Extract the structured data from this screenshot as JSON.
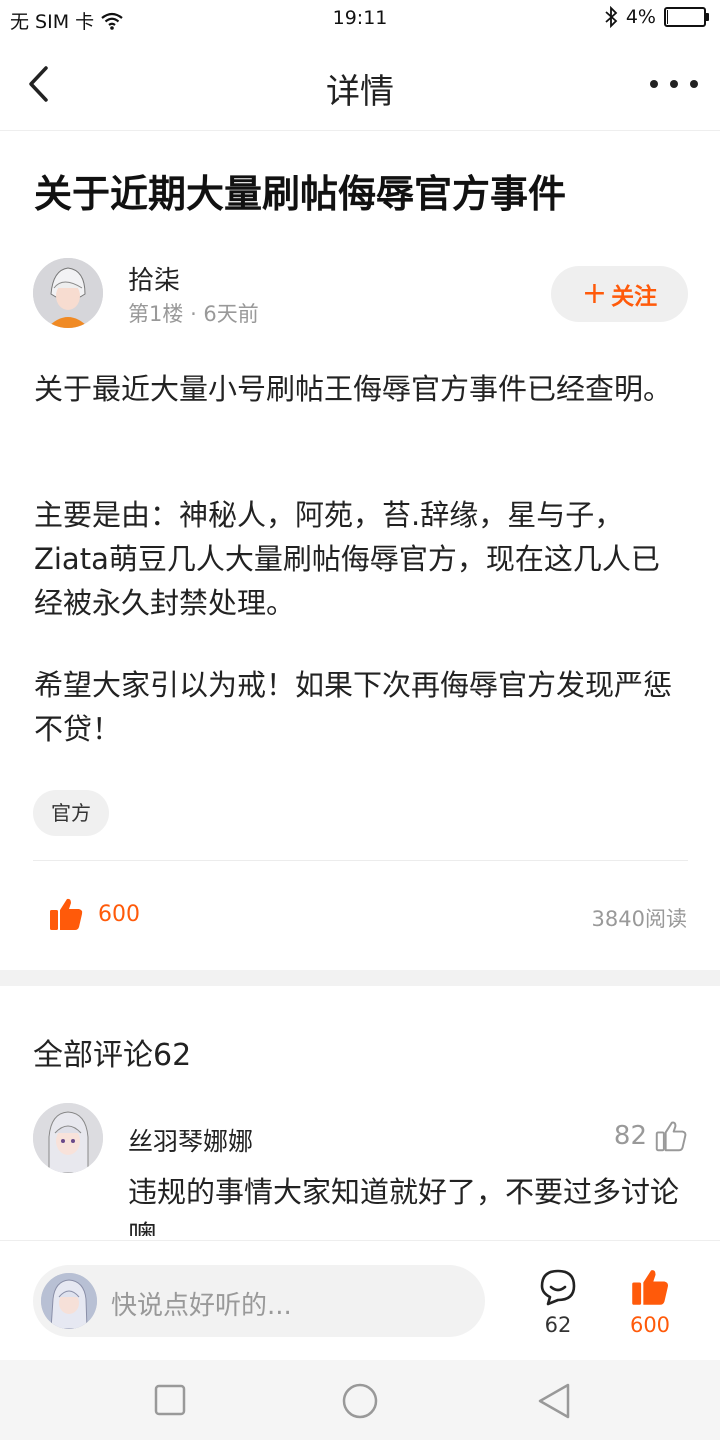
{
  "status_bar": {
    "carrier": "无 SIM 卡",
    "time": "19:11",
    "battery_text": "4%",
    "battery_level": 0.04
  },
  "nav": {
    "title": "详情"
  },
  "post": {
    "title": "关于近期大量刷帖侮辱官方事件",
    "author": "拾柒",
    "floor": "第1楼",
    "time_ago": "6天前",
    "follow_label": "关注",
    "paragraphs": [
      "关于最近大量小号刷帖王侮辱官方事件已经查明。",
      "主要是由：神秘人，阿苑，苔.辞缘，星与子，Ziata萌豆几人大量刷帖侮辱官方，现在这几人已经被永久封禁处理。",
      "希望大家引以为戒！如果下次再侮辱官方发现严惩不贷！"
    ],
    "tag": "官方",
    "likes": "600",
    "reads": "3840阅读"
  },
  "comments": {
    "title": "全部评论62",
    "items": [
      {
        "user": "丝羽琴娜娜",
        "likes": "82",
        "text": "违规的事情大家知道就好了，不要过多讨论噢"
      }
    ]
  },
  "bottom_bar": {
    "input_placeholder": "快说点好听的...",
    "comment_count": "62",
    "like_count": "600"
  },
  "colors": {
    "accent": "#ff5a0a",
    "muted": "#999999"
  },
  "icons": [
    "back-icon",
    "more-icon",
    "wifi-icon",
    "bluetooth-icon",
    "battery-icon",
    "thumbs-up-icon",
    "comment-icon",
    "square-icon",
    "circle-icon",
    "triangle-icon"
  ]
}
